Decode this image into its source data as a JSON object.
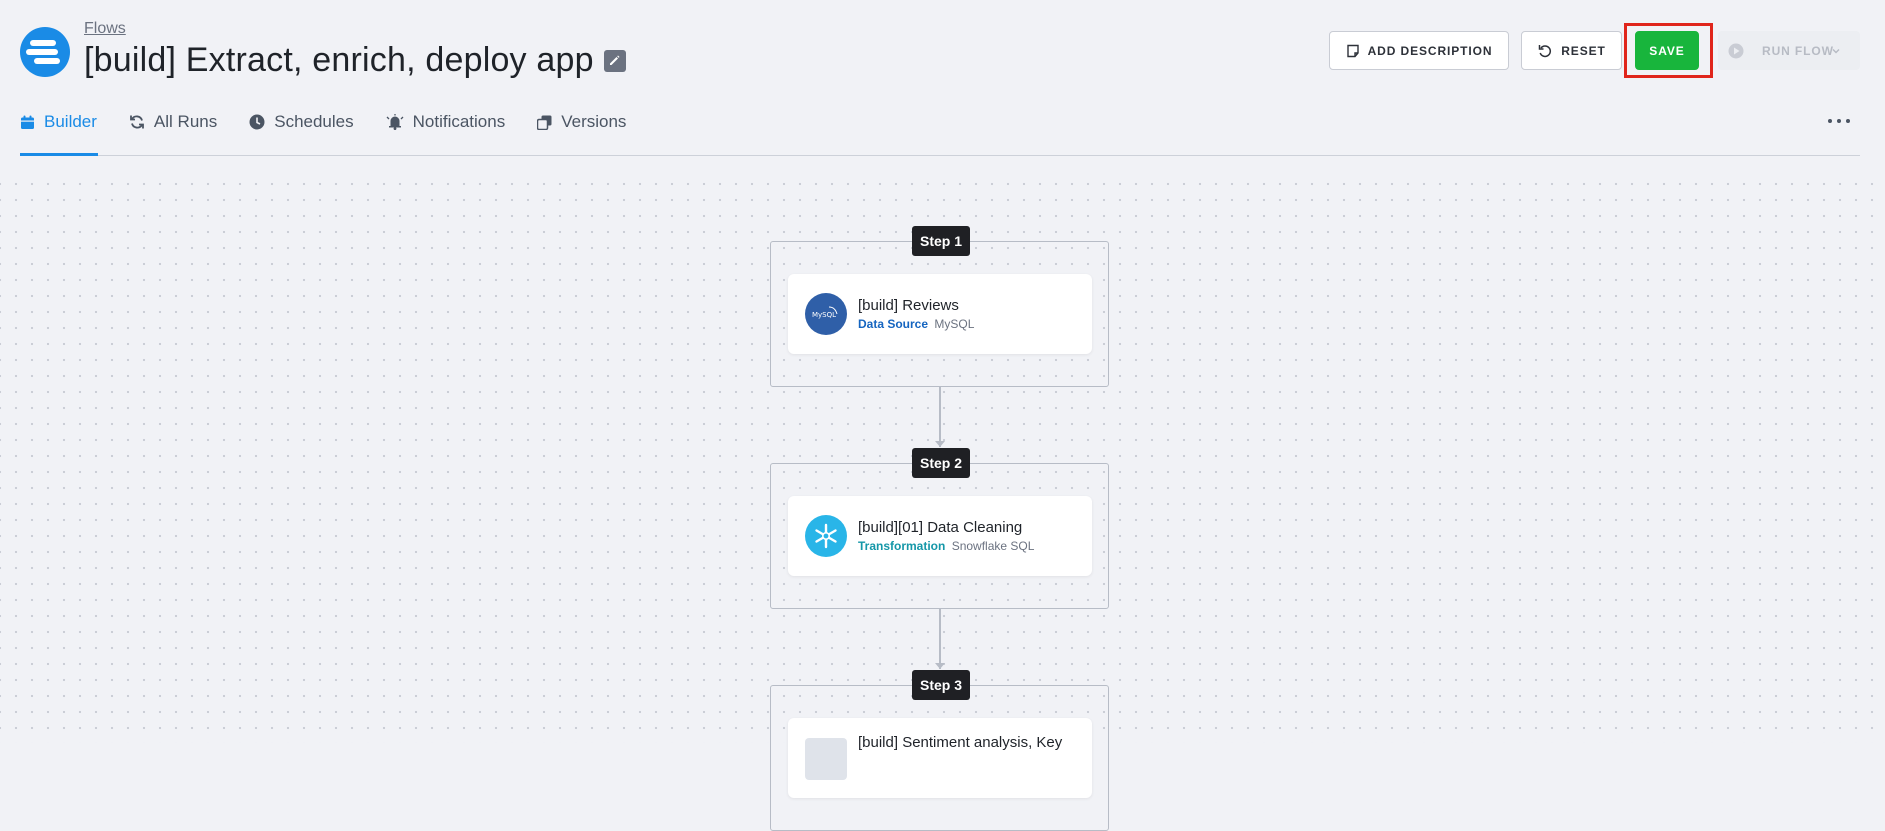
{
  "header": {
    "breadcrumb": "Flows",
    "title": "[build] Extract, enrich, deploy app"
  },
  "toolbar": {
    "add_description": "ADD DESCRIPTION",
    "reset": "RESET",
    "save": "SAVE",
    "run_flow": "RUN FLOW"
  },
  "tabs": [
    {
      "label": "Builder",
      "icon": "calendar-icon",
      "active": true
    },
    {
      "label": "All Runs",
      "icon": "refresh-icon"
    },
    {
      "label": "Schedules",
      "icon": "clock-icon"
    },
    {
      "label": "Notifications",
      "icon": "bell-icon"
    },
    {
      "label": "Versions",
      "icon": "copy-icon"
    }
  ],
  "steps": [
    {
      "badge": "Step 1",
      "name": "[build] Reviews",
      "type": "Data Source",
      "connector": "MySQL",
      "type_color": "#1565c0",
      "icon": "mysql-icon"
    },
    {
      "badge": "Step 2",
      "name": "[build][01] Data Cleaning",
      "type": "Transformation",
      "connector": "Snowflake SQL",
      "type_color": "#1597a8",
      "icon": "snowflake-icon"
    },
    {
      "badge": "Step 3",
      "name": "[build] Sentiment analysis, Key",
      "icon": "python-icon"
    }
  ],
  "colors": {
    "accent": "#1a8be6",
    "save": "#18b53c",
    "highlight": "#e0251b"
  }
}
